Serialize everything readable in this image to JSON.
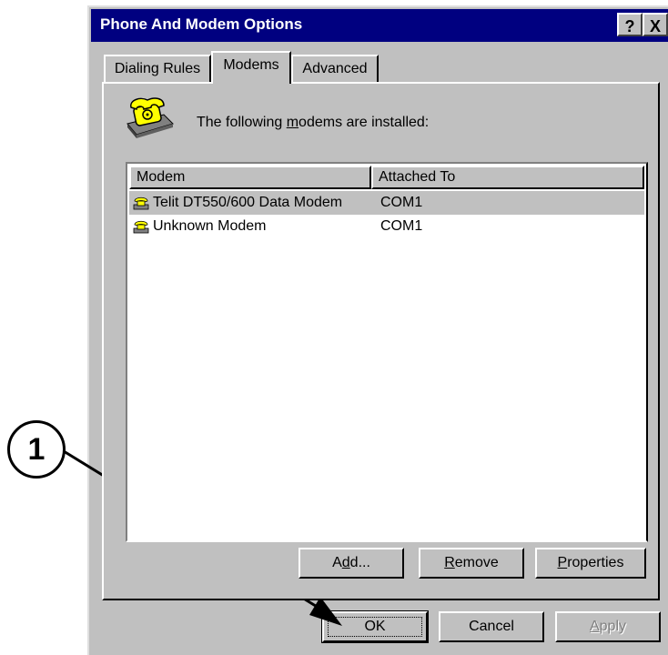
{
  "window": {
    "title": "Phone And Modem Options",
    "help_label": "?",
    "close_label": "X"
  },
  "tabs": [
    {
      "label": "Dialing Rules",
      "active": false
    },
    {
      "label": "Modems",
      "active": true
    },
    {
      "label": "Advanced",
      "active": false
    }
  ],
  "panel": {
    "intro_pre": "The following ",
    "intro_mnemonic": "m",
    "intro_post": "odems are  installed:",
    "icon": "modem-telephone-icon"
  },
  "list": {
    "columns": [
      "Modem",
      "Attached To"
    ],
    "rows": [
      {
        "modem": "Telit DT550/600 Data Modem",
        "port": "COM1",
        "selected": true
      },
      {
        "modem": "Unknown Modem",
        "port": "COM1",
        "selected": false
      }
    ]
  },
  "panel_buttons": {
    "add": {
      "pre": "A",
      "mnemonic": "d",
      "post": "d..."
    },
    "remove": {
      "mnemonic": "R",
      "post": "emove"
    },
    "properties": {
      "mnemonic": "P",
      "post": "roperties"
    }
  },
  "dialog_buttons": {
    "ok": "OK",
    "cancel": "Cancel",
    "apply": {
      "mnemonic": "A",
      "post": "pply",
      "disabled": true
    }
  },
  "callout": {
    "number": "1"
  },
  "colors": {
    "titlebar": "#000080",
    "face": "#c0c0c0",
    "selection": "#c0c0c0"
  }
}
